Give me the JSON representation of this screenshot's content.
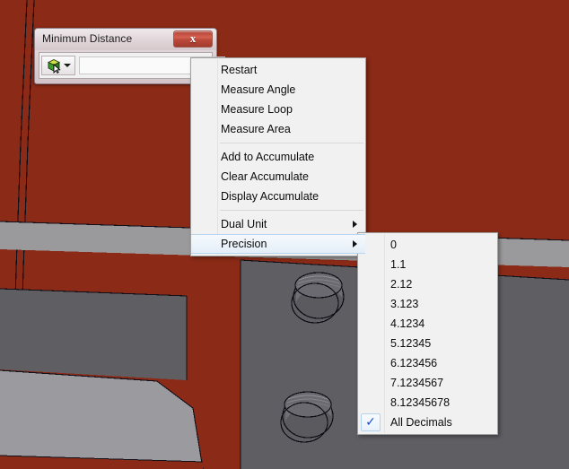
{
  "viewport": {
    "name": "cad-3d-viewport",
    "background_color": "#8b2a16",
    "surface_mid_gray": "#5e5e63",
    "surface_light_gray": "#9b9b9f",
    "surface_band_gray": "#9a9a9c",
    "edge_color": "#0d0d14"
  },
  "dialog": {
    "title": "Minimum Distance",
    "close_label": "x",
    "toolbar": {
      "cube_icon": "green-cube-select-icon",
      "dropdown_icon": "chevron-down-icon"
    },
    "value_field": {
      "value": "",
      "placeholder": ""
    }
  },
  "context_menu": {
    "items": [
      {
        "label": "Restart",
        "type": "item"
      },
      {
        "label": "Measure Angle",
        "type": "item"
      },
      {
        "label": "Measure Loop",
        "type": "item"
      },
      {
        "label": "Measure Area",
        "type": "item"
      },
      {
        "label": "",
        "type": "separator"
      },
      {
        "label": "Add to Accumulate",
        "type": "item"
      },
      {
        "label": "Clear Accumulate",
        "type": "item"
      },
      {
        "label": "Display Accumulate",
        "type": "item"
      },
      {
        "label": "",
        "type": "separator"
      },
      {
        "label": "Dual Unit",
        "type": "submenu"
      },
      {
        "label": "Precision",
        "type": "submenu",
        "selected": true
      }
    ]
  },
  "precision_submenu": {
    "items": [
      {
        "label": "0",
        "checked": false
      },
      {
        "label": "1.1",
        "checked": false
      },
      {
        "label": "2.12",
        "checked": false
      },
      {
        "label": "3.123",
        "checked": false
      },
      {
        "label": "4.1234",
        "checked": false
      },
      {
        "label": "5.12345",
        "checked": false
      },
      {
        "label": "6.123456",
        "checked": false
      },
      {
        "label": "7.1234567",
        "checked": false
      },
      {
        "label": "8.12345678",
        "checked": false
      },
      {
        "label": "All Decimals",
        "checked": true
      }
    ],
    "check_glyph": "✓"
  }
}
